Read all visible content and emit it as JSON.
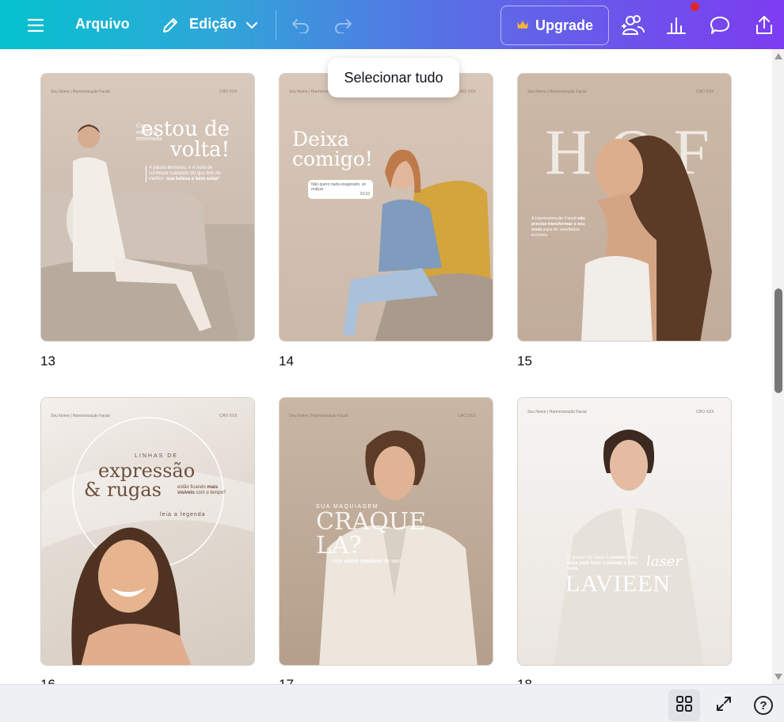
{
  "topbar": {
    "menu_icon": "hamburger-icon",
    "file_label": "Arquivo",
    "edit_label": "Edição",
    "upgrade_label": "Upgrade",
    "colors": {
      "gradient_start": "#05c2ce",
      "gradient_end": "#7d3cf0",
      "notif_dot": "#e0262b"
    }
  },
  "tooltip": {
    "text": "Selecionar tudo"
  },
  "pages": [
    {
      "number": "13",
      "brand": "Seu Nome | Harmonização Facial",
      "cro": "CRO XXX",
      "kicker": "Com energia renovada",
      "headline": "estou de volta!",
      "body": "A pausa terminou, e é hora de continuar cuidando do que tem de melhor:",
      "body_bold": "sua beleza e bem estar!"
    },
    {
      "number": "14",
      "brand": "Seu Nome | Harmonização Facial",
      "cro": "CRO XXX",
      "headline": "Deixa comigo!",
      "bubble": "Não quero nada exagerado, só realçar",
      "bubble_time": "10:10"
    },
    {
      "number": "15",
      "brand": "Seu Nome | Harmonização Facial",
      "cro": "CRO XXX",
      "headline": "HOF",
      "body_a": "A Harmonização Facial",
      "body_bold": "não precisa transformar o seu rosto",
      "body_b": "para ter resultados incríveis"
    },
    {
      "number": "16",
      "brand": "Seu Nome | Harmonização Facial",
      "cro": "CRO XXX",
      "kicker": "LINHAS DE",
      "headline_a": "expressão",
      "headline_b": "& rugas",
      "side_a": "estão ficando",
      "side_bold": "mais visíveis",
      "side_b": "com o tempo?",
      "cta": "leia a legenda"
    },
    {
      "number": "17",
      "brand": "Seu Nome | Harmonização Facial",
      "cro": "CRO XXX",
      "kicker": "SUA MAQUIAGEM",
      "headline": "CRAQUELA?",
      "body_a": "Veja",
      "body_bold": "como resolver",
      "body_b": "de vez!"
    },
    {
      "number": "18",
      "brand": "Seu Nome | Harmonização Facial",
      "cro": "CRO XXX",
      "body_a": "O poder do laser",
      "body_bold1": "Lavieen",
      "body_b": "para",
      "body_bold2": "uma pele bem cuidada o ano todo",
      "script": "laser",
      "headline": "LAVIEEN"
    }
  ],
  "bottombar": {
    "grid_icon": "grid-view-icon",
    "fullscreen_icon": "fullscreen-icon",
    "help_icon": "help-icon",
    "help_label": "?"
  }
}
